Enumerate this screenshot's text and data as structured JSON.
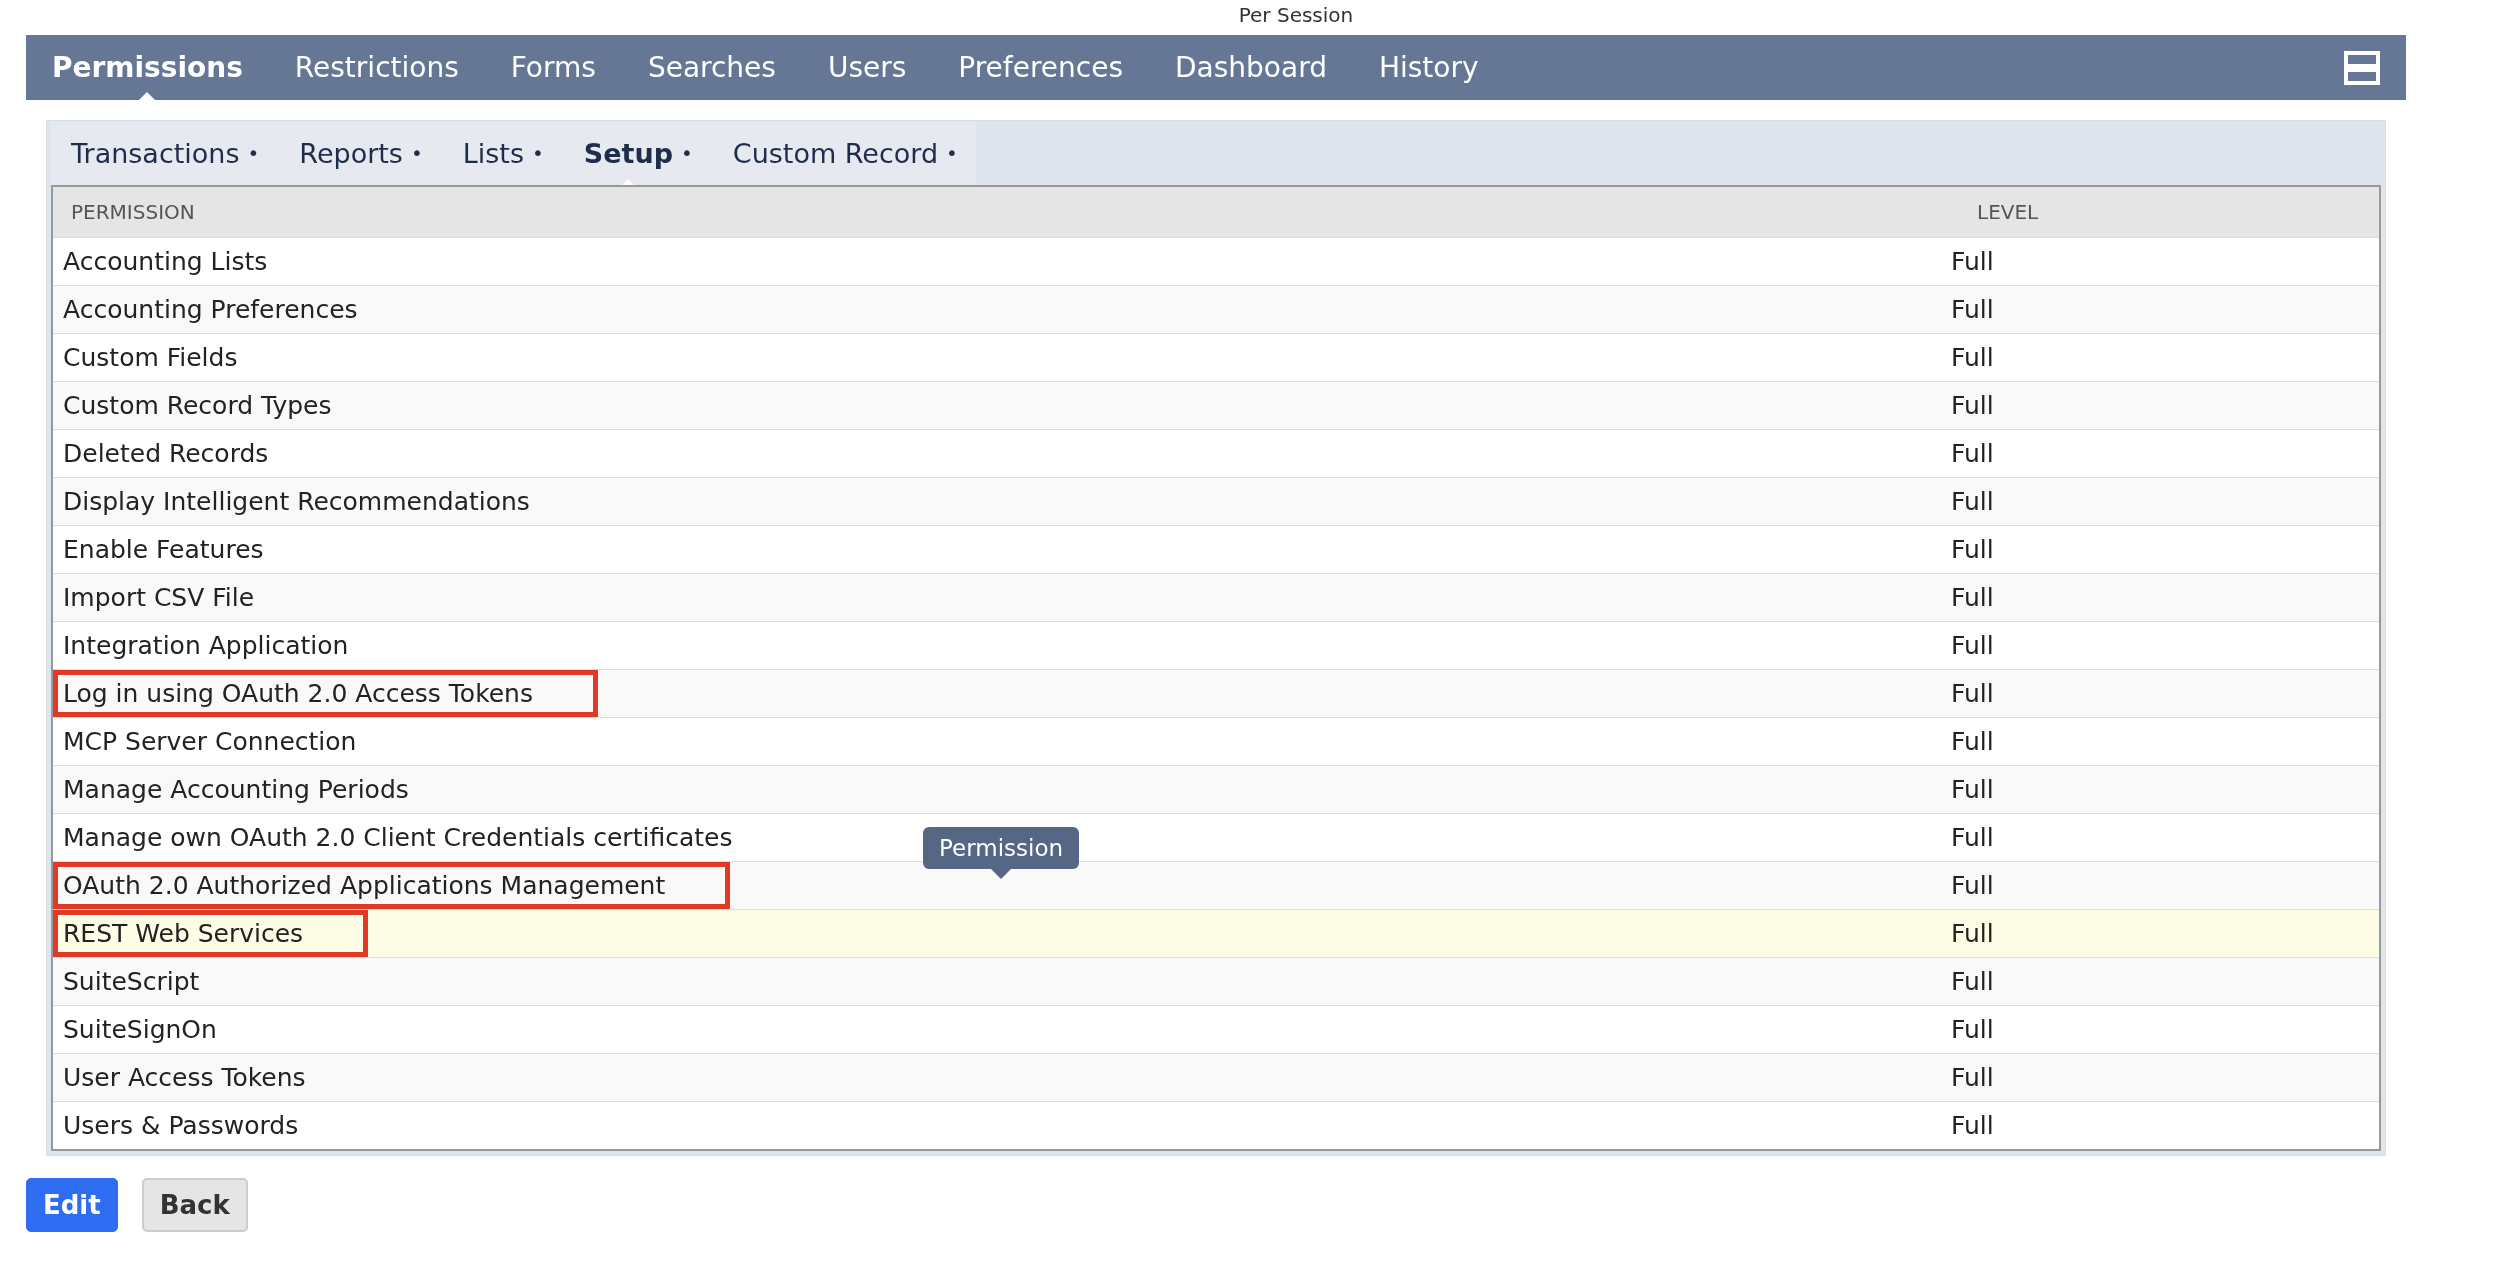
{
  "caption": "Per Session",
  "tabs": [
    {
      "label": "Permissions",
      "selected": true
    },
    {
      "label": "Restrictions",
      "selected": false
    },
    {
      "label": "Forms",
      "selected": false
    },
    {
      "label": "Searches",
      "selected": false
    },
    {
      "label": "Users",
      "selected": false
    },
    {
      "label": "Preferences",
      "selected": false
    },
    {
      "label": "Dashboard",
      "selected": false
    },
    {
      "label": "History",
      "selected": false
    }
  ],
  "subtabs": [
    {
      "label": "Transactions",
      "marker": "•",
      "selected": false
    },
    {
      "label": "Reports",
      "marker": "•",
      "selected": false
    },
    {
      "label": "Lists",
      "marker": "•",
      "selected": false
    },
    {
      "label": "Setup",
      "marker": "•",
      "selected": true
    },
    {
      "label": "Custom Record",
      "marker": "•",
      "selected": false
    }
  ],
  "table": {
    "columns": [
      "PERMISSION",
      "LEVEL"
    ],
    "rows": [
      {
        "permission": "Accounting Lists",
        "level": "Full",
        "highlighted": false,
        "hovered": false
      },
      {
        "permission": "Accounting Preferences",
        "level": "Full",
        "highlighted": false,
        "hovered": false
      },
      {
        "permission": "Custom Fields",
        "level": "Full",
        "highlighted": false,
        "hovered": false
      },
      {
        "permission": "Custom Record Types",
        "level": "Full",
        "highlighted": false,
        "hovered": false
      },
      {
        "permission": "Deleted Records",
        "level": "Full",
        "highlighted": false,
        "hovered": false
      },
      {
        "permission": "Display Intelligent Recommendations",
        "level": "Full",
        "highlighted": false,
        "hovered": false
      },
      {
        "permission": "Enable Features",
        "level": "Full",
        "highlighted": false,
        "hovered": false
      },
      {
        "permission": "Import CSV File",
        "level": "Full",
        "highlighted": false,
        "hovered": false
      },
      {
        "permission": "Integration Application",
        "level": "Full",
        "highlighted": false,
        "hovered": false
      },
      {
        "permission": "Log in using OAuth 2.0 Access Tokens",
        "level": "Full",
        "highlighted": true,
        "hovered": false
      },
      {
        "permission": "MCP Server Connection",
        "level": "Full",
        "highlighted": false,
        "hovered": false
      },
      {
        "permission": "Manage Accounting Periods",
        "level": "Full",
        "highlighted": false,
        "hovered": false
      },
      {
        "permission": "Manage own OAuth 2.0 Client Credentials certificates",
        "level": "Full",
        "highlighted": false,
        "hovered": false
      },
      {
        "permission": "OAuth 2.0 Authorized Applications Management",
        "level": "Full",
        "highlighted": true,
        "hovered": false
      },
      {
        "permission": "REST Web Services",
        "level": "Full",
        "highlighted": true,
        "hovered": true
      },
      {
        "permission": "SuiteScript",
        "level": "Full",
        "highlighted": false,
        "hovered": false
      },
      {
        "permission": "SuiteSignOn",
        "level": "Full",
        "highlighted": false,
        "hovered": false
      },
      {
        "permission": "User Access Tokens",
        "level": "Full",
        "highlighted": false,
        "hovered": false
      },
      {
        "permission": "Users & Passwords",
        "level": "Full",
        "highlighted": false,
        "hovered": false
      }
    ]
  },
  "tooltip": "Permission",
  "buttons": [
    {
      "label": "Edit",
      "kind": "primary"
    },
    {
      "label": "Back",
      "kind": "secondary"
    }
  ]
}
